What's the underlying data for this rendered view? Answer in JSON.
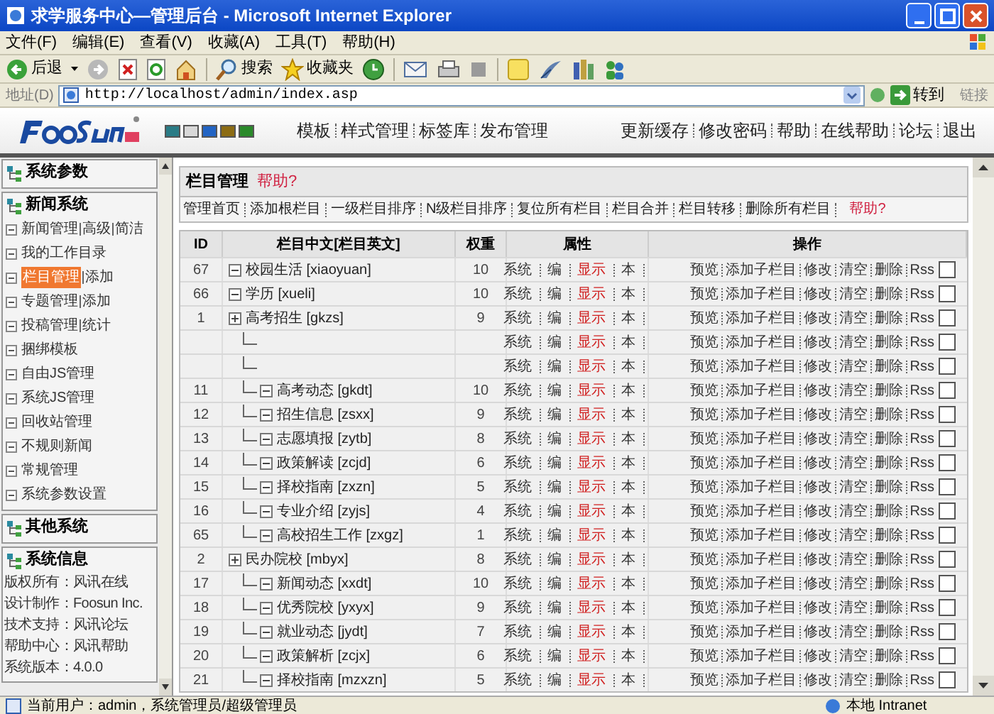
{
  "window": {
    "title": "求学服务中心—管理后台 - Microsoft Internet Explorer"
  },
  "menu": [
    "文件(F)",
    "编辑(E)",
    "查看(V)",
    "收藏(A)",
    "工具(T)",
    "帮助(H)"
  ],
  "toolbar": {
    "back": "后退",
    "search": "搜索",
    "favorites": "收藏夹"
  },
  "address": {
    "label": "地址(D)",
    "value": "http://localhost/admin/index.asp",
    "go": "转到",
    "links": "链接"
  },
  "app_header": {
    "themes": [
      {
        "color": "#2a7c86"
      },
      {
        "color": "#d8d8d8"
      },
      {
        "color": "#2264c4"
      },
      {
        "color": "#8c6c14"
      },
      {
        "color": "#2a8a2a"
      }
    ],
    "nav": [
      "模板",
      "样式管理",
      "标签库",
      "发布管理"
    ],
    "right_nav": [
      "更新缓存",
      "修改密码",
      "帮助",
      "在线帮助",
      "论坛",
      "退出"
    ]
  },
  "sidebar": {
    "sections": [
      {
        "title": "系统参数"
      },
      {
        "title": "新闻系统",
        "items": [
          {
            "links": [
              "新闻管理",
              "高级",
              "简洁"
            ],
            "selected": false
          },
          {
            "links": [
              "我的工作目录"
            ],
            "selected": false
          },
          {
            "links": [
              "栏目管理",
              "添加"
            ],
            "selected": true
          },
          {
            "links": [
              "专题管理",
              "添加"
            ],
            "selected": false
          },
          {
            "links": [
              "投稿管理",
              "统计"
            ],
            "selected": false
          },
          {
            "links": [
              "捆绑模板"
            ],
            "selected": false
          },
          {
            "links": [
              "自由JS管理"
            ],
            "selected": false
          },
          {
            "links": [
              "系统JS管理"
            ],
            "selected": false
          },
          {
            "links": [
              "回收站管理"
            ],
            "selected": false
          },
          {
            "links": [
              "不规则新闻"
            ],
            "selected": false
          },
          {
            "links": [
              "常规管理"
            ],
            "selected": false
          },
          {
            "links": [
              "系统参数设置"
            ],
            "selected": false
          }
        ]
      },
      {
        "title": "其他系统"
      },
      {
        "title": "系统信息",
        "lines": [
          "版权所有：风讯在线",
          "设计制作：Foosun Inc.",
          "技术支持：风讯论坛",
          "帮助中心：风讯帮助",
          "系统版本：4.0.0"
        ]
      }
    ]
  },
  "panel": {
    "title": "栏目管理",
    "help": "帮助?",
    "links": [
      "管理首页",
      "添加根栏目",
      "一级栏目排序",
      "N级栏目排序",
      "复位所有栏目",
      "栏目合并",
      "栏目转移",
      "删除所有栏目"
    ],
    "links_help": "帮助?"
  },
  "table": {
    "columns": [
      "ID",
      "栏目中文[栏目英文]",
      "权重",
      "属性",
      "操作"
    ],
    "rows": [
      {
        "id": "67",
        "name": "校园生活 [xiaoyuan]",
        "expanded": true,
        "weight": "10",
        "attrs": [
          "系统",
          "编",
          "显示",
          "本"
        ],
        "actions": [
          "预览",
          "添加子栏目",
          "修改",
          "清空",
          "删除",
          "Rss"
        ],
        "checked": false
      },
      {
        "id": "66",
        "name": "学历 [xueli]",
        "expanded": true,
        "weight": "10",
        "attrs": [
          "系统",
          "编",
          "显示",
          "本"
        ],
        "actions": [
          "预览",
          "添加子栏目",
          "修改",
          "清空",
          "删除",
          "Rss"
        ],
        "checked": false
      },
      {
        "id": "1",
        "name": "高考招生 [gkzs]",
        "expanded": false,
        "weight": "9",
        "attrs": [
          "系统",
          "编",
          "显示",
          "本"
        ],
        "actions": [
          "预览",
          "添加子栏目",
          "修改",
          "清空",
          "删除",
          "Rss"
        ],
        "checked": false,
        "children": [
          {
            "attrs": [
              "系统",
              "编",
              "显示",
              "本"
            ],
            "actions": [
              "预览",
              "添加子栏目",
              "修改",
              "清空",
              "删除",
              "Rss"
            ],
            "checked": false
          },
          {
            "attrs": [
              "系统",
              "编",
              "显示",
              "本"
            ],
            "actions": [
              "预览",
              "添加子栏目",
              "修改",
              "清空",
              "删除",
              "Rss"
            ],
            "checked": false
          },
          {
            "id": "11",
            "name": "高考动态 [gkdt]",
            "expanded": true,
            "weight": "10",
            "attrs": [
              "系统",
              "编",
              "显示",
              "本"
            ],
            "actions": [
              "预览",
              "添加子栏目",
              "修改",
              "清空",
              "删除",
              "Rss"
            ],
            "checked": false
          },
          {
            "id": "12",
            "name": "招生信息 [zsxx]",
            "expanded": true,
            "weight": "9",
            "attrs": [
              "系统",
              "编",
              "显示",
              "本"
            ],
            "actions": [
              "预览",
              "添加子栏目",
              "修改",
              "清空",
              "删除",
              "Rss"
            ],
            "checked": false
          },
          {
            "id": "13",
            "name": "志愿填报 [zytb]",
            "expanded": true,
            "weight": "8",
            "attrs": [
              "系统",
              "编",
              "显示",
              "本"
            ],
            "actions": [
              "预览",
              "添加子栏目",
              "修改",
              "清空",
              "删除",
              "Rss"
            ],
            "checked": false
          },
          {
            "id": "14",
            "name": "政策解读 [zcjd]",
            "expanded": true,
            "weight": "6",
            "attrs": [
              "系统",
              "编",
              "显示",
              "本"
            ],
            "actions": [
              "预览",
              "添加子栏目",
              "修改",
              "清空",
              "删除",
              "Rss"
            ],
            "checked": false
          },
          {
            "id": "15",
            "name": "择校指南 [zxzn]",
            "expanded": true,
            "weight": "5",
            "attrs": [
              "系统",
              "编",
              "显示",
              "本"
            ],
            "actions": [
              "预览",
              "添加子栏目",
              "修改",
              "清空",
              "删除",
              "Rss"
            ],
            "checked": false
          },
          {
            "id": "16",
            "name": "专业介绍 [zyjs]",
            "expanded": true,
            "weight": "4",
            "attrs": [
              "系统",
              "编",
              "显示",
              "本"
            ],
            "actions": [
              "预览",
              "添加子栏目",
              "修改",
              "清空",
              "删除",
              "Rss"
            ],
            "checked": false
          },
          {
            "id": "65",
            "name": "高校招生工作 [zxgz]",
            "expanded": true,
            "weight": "1",
            "attrs": [
              "系统",
              "编",
              "显示",
              "本"
            ],
            "actions": [
              "预览",
              "添加子栏目",
              "修改",
              "清空",
              "删除",
              "Rss"
            ],
            "checked": false
          }
        ]
      },
      {
        "id": "2",
        "name": "民办院校 [mbyx]",
        "expanded": false,
        "weight": "8",
        "attrs": [
          "系统",
          "编",
          "显示",
          "本"
        ],
        "actions": [
          "预览",
          "添加子栏目",
          "修改",
          "清空",
          "删除",
          "Rss"
        ],
        "checked": false,
        "children": [
          {
            "id": "17",
            "name": "新闻动态 [xxdt]",
            "expanded": true,
            "weight": "10",
            "attrs": [
              "系统",
              "编",
              "显示",
              "本"
            ],
            "actions": [
              "预览",
              "添加子栏目",
              "修改",
              "清空",
              "删除",
              "Rss"
            ],
            "checked": false
          },
          {
            "id": "18",
            "name": "优秀院校 [yxyx]",
            "expanded": true,
            "weight": "9",
            "attrs": [
              "系统",
              "编",
              "显示",
              "本"
            ],
            "actions": [
              "预览",
              "添加子栏目",
              "修改",
              "清空",
              "删除",
              "Rss"
            ],
            "checked": false
          },
          {
            "id": "19",
            "name": "就业动态 [jydt]",
            "expanded": true,
            "weight": "7",
            "attrs": [
              "系统",
              "编",
              "显示",
              "本"
            ],
            "actions": [
              "预览",
              "添加子栏目",
              "修改",
              "清空",
              "删除",
              "Rss"
            ],
            "checked": false
          },
          {
            "id": "20",
            "name": "政策解析 [zcjx]",
            "expanded": true,
            "weight": "6",
            "attrs": [
              "系统",
              "编",
              "显示",
              "本"
            ],
            "actions": [
              "预览",
              "添加子栏目",
              "修改",
              "清空",
              "删除",
              "Rss"
            ],
            "checked": false
          },
          {
            "id": "21",
            "name": "择校指南 [mzxzn]",
            "expanded": true,
            "weight": "5",
            "attrs": [
              "系统",
              "编",
              "显示",
              "本"
            ],
            "actions": [
              "预览",
              "添加子栏目",
              "修改",
              "清空",
              "删除",
              "Rss"
            ],
            "checked": false
          }
        ]
      }
    ]
  },
  "status_bar": {
    "text": "当前用户：admin，系统管理员/超级管理员",
    "zone": "本地 Intranet"
  }
}
